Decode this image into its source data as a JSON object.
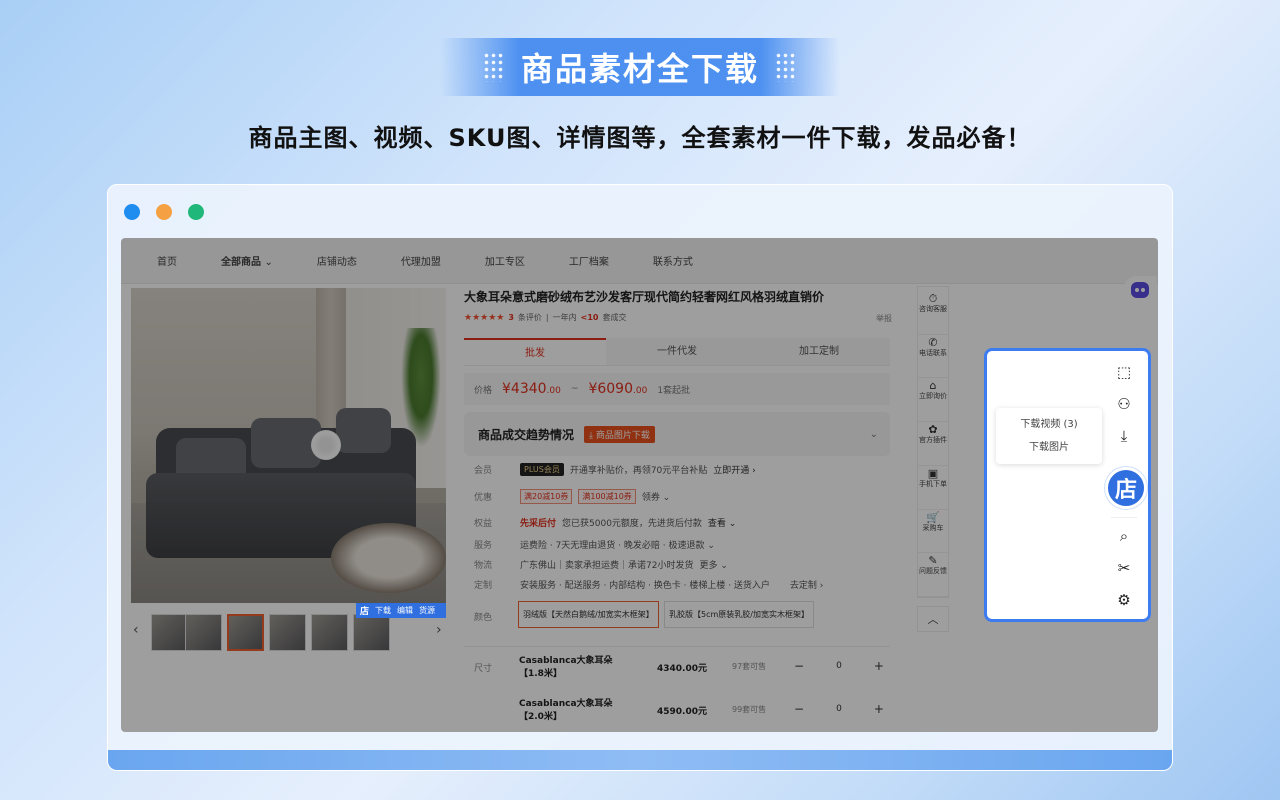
{
  "headline": "商品素材全下载",
  "subtitle": "商品主图、视频、SKU图、详情图等，全套素材一件下载，发品必备！",
  "nav": [
    "首页",
    "全部商品",
    "店铺动态",
    "代理加盟",
    "加工专区",
    "工厂档案",
    "联系方式"
  ],
  "nav_chevron": "⌄",
  "image_bar": {
    "store": "店",
    "download": "下载",
    "edit": "编辑",
    "source": "货源"
  },
  "product": {
    "title": "大象耳朵意式磨砂绒布艺沙发客厅现代简约轻奢网红风格羽绒直销价",
    "stars": "★★★★★",
    "reviews_count": "3",
    "reviews_label": "条评价",
    "sep": "|",
    "sold_prefix": "一年内",
    "sold_count": "<10",
    "sold_suffix": "套成交",
    "report": "举报"
  },
  "tabs": [
    "批发",
    "一件代发",
    "加工定制"
  ],
  "price": {
    "label": "价格",
    "low": "¥4340",
    "low_dec": ".00",
    "tilde": "~",
    "high": "¥6090",
    "high_dec": ".00",
    "moq": "1套起批"
  },
  "trend": {
    "label": "商品成交趋势情况",
    "button": "商品图片下载",
    "chevron": "⌄"
  },
  "rows": {
    "member": {
      "k": "会员",
      "badge": "PLUS会员",
      "text": "开通享补贴价，再领70元平台补贴",
      "link": "立即开通 ›"
    },
    "discount": {
      "k": "优惠",
      "c1": "满20减10券",
      "c2": "满100减10券",
      "link": "领券 ⌄"
    },
    "rights": {
      "k": "权益",
      "hl": "先采后付",
      "text": "您已获5000元额度，先进货后付款",
      "link": "查看 ⌄"
    },
    "service": {
      "k": "服务",
      "text": "运费险 · 7天无理由退货 · 晚发必赔 · 极速退款 ⌄"
    },
    "logistics": {
      "k": "物流",
      "text": "广东佛山｜卖家承担运费｜承诺72小时发货",
      "link": "更多 ⌄"
    },
    "custom": {
      "k": "定制",
      "text": "安装服务 · 配送服务 · 内部结构 · 换色卡 · 楼梯上楼 · 送货入户",
      "link": "去定制 ›"
    }
  },
  "colors": {
    "k": "颜色",
    "opt1": "羽绒版【天然白鹅绒/加宽实木框架】",
    "opt2": "乳胶版【5cm原装乳胶/加宽实木框架】"
  },
  "sizes": {
    "k": "尺寸",
    "items": [
      {
        "name": "Casablanca大象耳朵【1.8米】",
        "price": "4340.00元",
        "stock": "97套可售",
        "minus": "−",
        "qty": "0",
        "plus": "+"
      },
      {
        "name": "Casablanca大象耳朵【2.0米】",
        "price": "4590.00元",
        "stock": "99套可售",
        "minus": "−",
        "qty": "0",
        "plus": "+"
      }
    ]
  },
  "sidetools": [
    {
      "icon": "⏱",
      "label": "咨询客服"
    },
    {
      "icon": "✆",
      "label": "电话联系"
    },
    {
      "icon": "⌂",
      "label": "立即询价"
    },
    {
      "icon": "✿",
      "label": "官方插件"
    },
    {
      "icon": "▣",
      "label": "手机下单"
    },
    {
      "icon": "🛒",
      "label": "采购车"
    },
    {
      "icon": "✎",
      "label": "问题反馈"
    }
  ],
  "up_arrow": "︿",
  "panel": {
    "menu": [
      "下载视频 (3)",
      "下载图片"
    ],
    "store_char": "店",
    "tool_icons": {
      "box": "⬚",
      "user": "⚇",
      "download": "⤓",
      "search": "⌕",
      "scissors": "✂",
      "settings": "⚙"
    }
  },
  "arrows": {
    "left": "‹",
    "right": "›"
  },
  "colors_theme": {
    "accent": "#2f6fe0",
    "price_red": "#e0301e",
    "panel_border": "#3d7cf0"
  }
}
